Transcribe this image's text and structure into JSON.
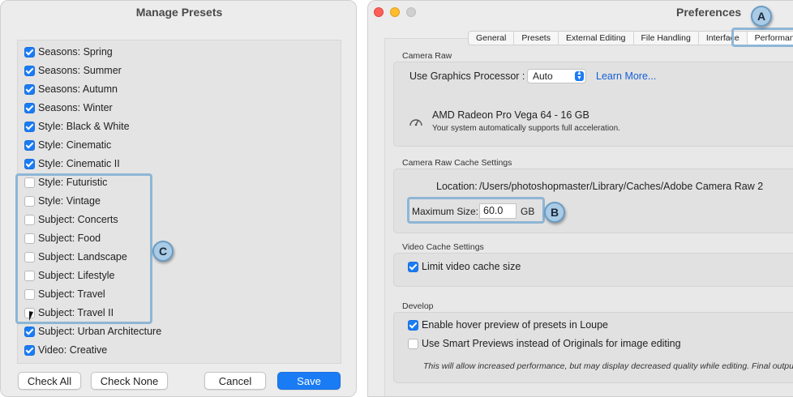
{
  "manage_presets": {
    "title": "Manage Presets",
    "items": [
      {
        "label": "Seasons: Spring",
        "checked": true
      },
      {
        "label": "Seasons: Summer",
        "checked": true
      },
      {
        "label": "Seasons: Autumn",
        "checked": true
      },
      {
        "label": "Seasons: Winter",
        "checked": true
      },
      {
        "label": "Style: Black & White",
        "checked": true
      },
      {
        "label": "Style: Cinematic",
        "checked": true
      },
      {
        "label": "Style: Cinematic II",
        "checked": true
      },
      {
        "label": "Style: Futuristic",
        "checked": false
      },
      {
        "label": "Style: Vintage",
        "checked": false
      },
      {
        "label": "Subject: Concerts",
        "checked": false
      },
      {
        "label": "Subject: Food",
        "checked": false
      },
      {
        "label": "Subject: Landscape",
        "checked": false
      },
      {
        "label": "Subject: Lifestyle",
        "checked": false
      },
      {
        "label": "Subject: Travel",
        "checked": false
      },
      {
        "label": "Subject: Travel II",
        "checked": false
      },
      {
        "label": "Subject: Urban Architecture",
        "checked": true
      },
      {
        "label": "Video: Creative",
        "checked": true
      }
    ],
    "buttons": {
      "check_all": "Check All",
      "check_none": "Check None",
      "cancel": "Cancel",
      "save": "Save"
    },
    "callout": "C"
  },
  "preferences": {
    "title": "Preferences",
    "tabs": [
      "General",
      "Presets",
      "External Editing",
      "File Handling",
      "Interface",
      "Performance"
    ],
    "active_tab": "Performance",
    "callout_a": "A",
    "camera_raw": {
      "section": "Camera Raw",
      "gpu_label": "Use Graphics Processor :",
      "gpu_value": "Auto",
      "learn_more": "Learn More...",
      "gpu_name": "AMD Radeon Pro Vega 64 - 16 GB",
      "gpu_note": "Your system automatically supports full acceleration."
    },
    "cache": {
      "section": "Camera Raw Cache Settings",
      "location_label": "Location:",
      "location_path": "/Users/photoshopmaster/Library/Caches/Adobe Camera Raw 2",
      "max_size_label": "Maximum Size:",
      "max_size_value": "60.0",
      "unit": "GB",
      "callout_b": "B"
    },
    "video_cache": {
      "section": "Video Cache Settings",
      "limit_label": "Limit video cache size",
      "limit_checked": true
    },
    "develop": {
      "section": "Develop",
      "hover_label": "Enable hover preview of presets in Loupe",
      "hover_checked": true,
      "smart_label": "Use Smart Previews instead of Originals for image editing",
      "smart_checked": false,
      "note": "This will allow increased performance, but may display decreased quality while editing. Final output will re"
    }
  },
  "colors": {
    "accent": "#1a7cf5",
    "callout": "#8eb6d6"
  }
}
